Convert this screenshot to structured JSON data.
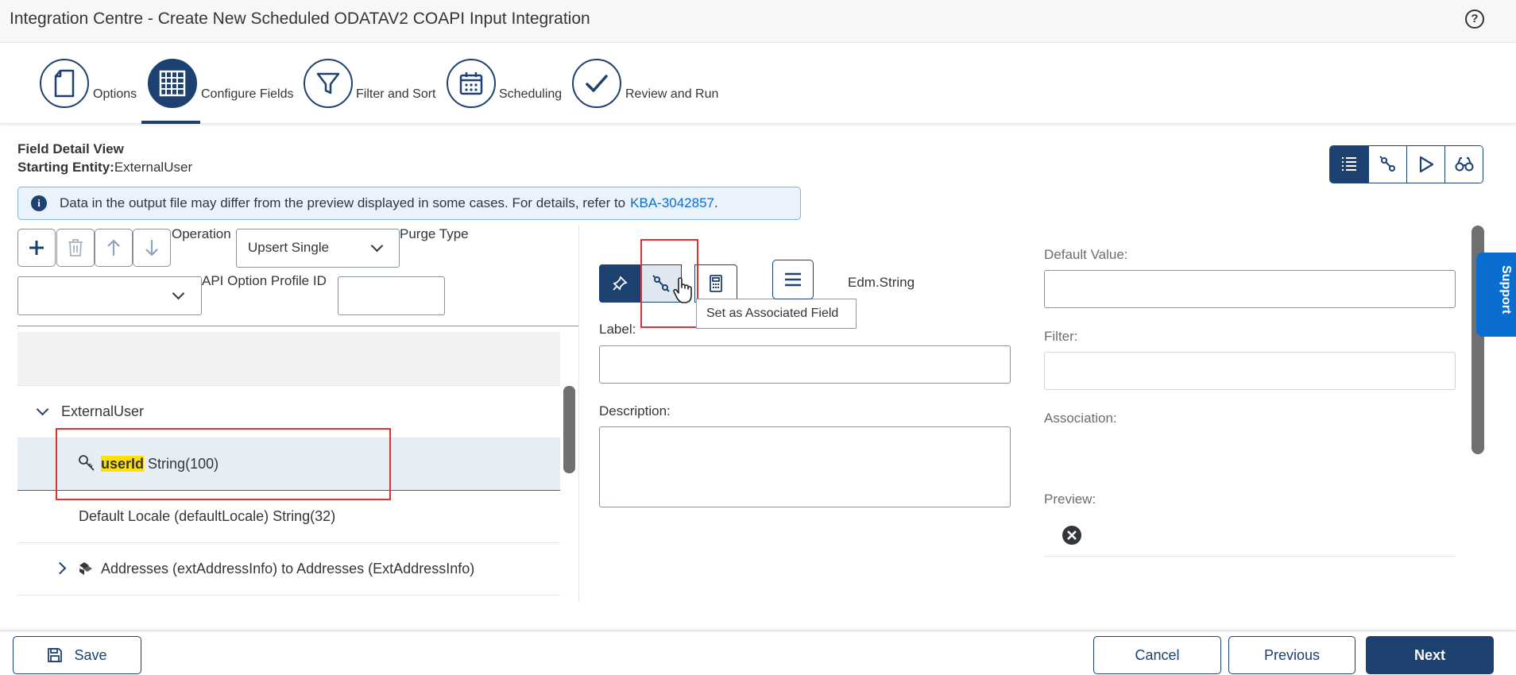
{
  "window": {
    "title": "Integration Centre - Create New Scheduled ODATAV2 COAPI Input Integration"
  },
  "wizard": {
    "steps": [
      {
        "label": "Options",
        "icon": "document-icon"
      },
      {
        "label": "Configure Fields",
        "icon": "grid-icon",
        "active": true
      },
      {
        "label": "Filter and Sort",
        "icon": "filter-icon"
      },
      {
        "label": "Scheduling",
        "icon": "calendar-icon"
      },
      {
        "label": "Review and Run",
        "icon": "checkmark-icon"
      }
    ]
  },
  "field_detail": {
    "title": "Field Detail View",
    "entity_label": "Starting Entity:",
    "entity_value": "ExternalUser"
  },
  "info": {
    "text": "Data in the output file may differ from the preview displayed in some cases. For details, refer to",
    "link": "KBA-3042857",
    "suffix": "."
  },
  "toolbar": {
    "operation_label": "Operation",
    "operation_value": "Upsert Single",
    "purge_type_label": "Purge Type",
    "purge_type_value": "",
    "api_option_label": "API Option Profile ID",
    "api_option_value": ""
  },
  "tree": {
    "root": "ExternalUser",
    "field_key": "userId",
    "field_type": "String(100)",
    "row2": "Default Locale (defaultLocale) String(32)",
    "row3": "Addresses (extAddressInfo) to Addresses (ExtAddressInfo)"
  },
  "middle": {
    "type": "Edm.String",
    "tooltip": "Set as Associated Field",
    "label_label": "Label:",
    "label_value": "",
    "description_label": "Description:",
    "description_value": ""
  },
  "right": {
    "default_value_label": "Default Value:",
    "default_value": "",
    "filter_label": "Filter:",
    "filter_value": "",
    "association_label": "Association:",
    "preview_label": "Preview:"
  },
  "support": {
    "label": "Support"
  },
  "footer": {
    "save": "Save",
    "cancel": "Cancel",
    "previous": "Previous",
    "next": "Next"
  },
  "colors": {
    "primary": "#1d4170",
    "link": "#0a6ed1",
    "highlight": "#ffe000",
    "annotation": "#e0302f"
  }
}
